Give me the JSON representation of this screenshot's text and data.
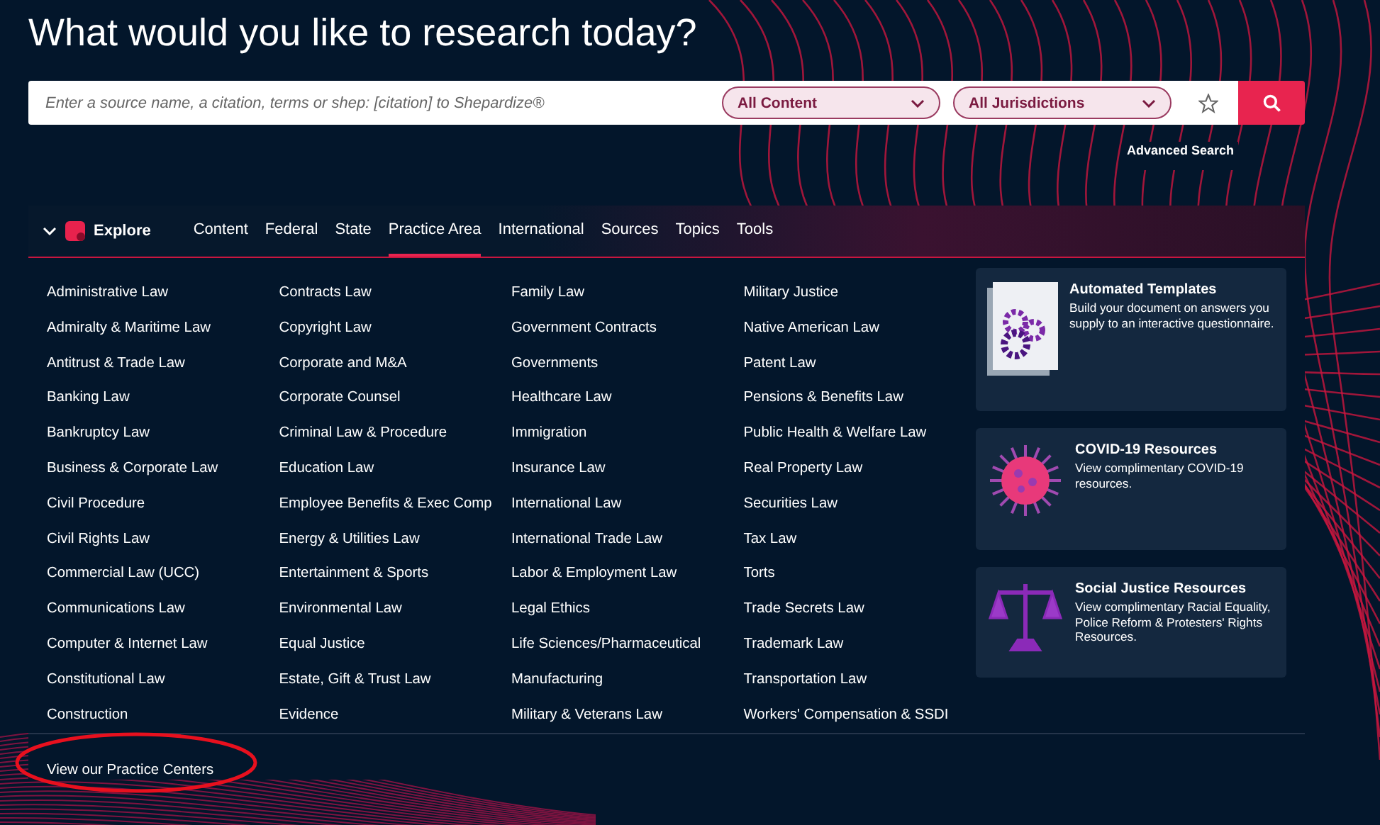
{
  "heading": "What would you like to research today?",
  "search": {
    "placeholder": "Enter a source name, a citation, terms or shep: [citation] to Shepardize®",
    "content_filter": "All Content",
    "jurisdiction_filter": "All Jurisdictions"
  },
  "advanced_search": "Advanced Search",
  "explore": {
    "label": "Explore",
    "expanded": true,
    "tabs": [
      {
        "label": "Content",
        "selected": false
      },
      {
        "label": "Federal",
        "selected": false
      },
      {
        "label": "State",
        "selected": false
      },
      {
        "label": "Practice Area",
        "selected": true
      },
      {
        "label": "International",
        "selected": false
      },
      {
        "label": "Sources",
        "selected": false
      },
      {
        "label": "Topics",
        "selected": false
      },
      {
        "label": "Tools",
        "selected": false
      }
    ]
  },
  "practice_areas": [
    [
      "Administrative Law",
      "Admiralty & Maritime Law",
      "Antitrust & Trade Law",
      "Banking Law",
      "Bankruptcy Law",
      "Business & Corporate Law",
      "Civil Procedure",
      "Civil Rights Law",
      "Commercial Law (UCC)",
      "Communications Law",
      "Computer & Internet Law",
      "Constitutional Law",
      "Construction"
    ],
    [
      "Contracts Law",
      "Copyright Law",
      "Corporate and M&A",
      "Corporate Counsel",
      "Criminal Law & Procedure",
      "Education Law",
      "Employee Benefits & Exec Comp",
      "Energy & Utilities Law",
      "Entertainment & Sports",
      "Environmental Law",
      "Equal Justice",
      "Estate, Gift & Trust Law",
      "Evidence"
    ],
    [
      "Family Law",
      "Government Contracts",
      "Governments",
      "Healthcare Law",
      "Immigration",
      "Insurance Law",
      "International Law",
      "International Trade Law",
      "Labor & Employment Law",
      "Legal Ethics",
      "Life Sciences/Pharmaceutical",
      "Manufacturing",
      "Military & Veterans Law"
    ],
    [
      "Military Justice",
      "Native American Law",
      "Patent Law",
      "Pensions & Benefits Law",
      "Public Health & Welfare Law",
      "Real Property Law",
      "Securities Law",
      "Tax Law",
      "Torts",
      "Trade Secrets Law",
      "Trademark Law",
      "Transportation Law",
      "Workers' Compensation & SSDI"
    ]
  ],
  "cards": [
    {
      "kind": "templates",
      "title": "Automated Templates",
      "text": "Build your document on answers you supply to an interactive questionnaire."
    },
    {
      "kind": "virus",
      "title": "COVID-19 Resources",
      "text": "View complimentary COVID-19 resources."
    },
    {
      "kind": "scales",
      "title": "Social Justice Resources",
      "text": "View complimentary Racial Equality, Police Reform & Protesters' Rights Resources."
    }
  ],
  "practice_centers_link": "View our Practice Centers"
}
